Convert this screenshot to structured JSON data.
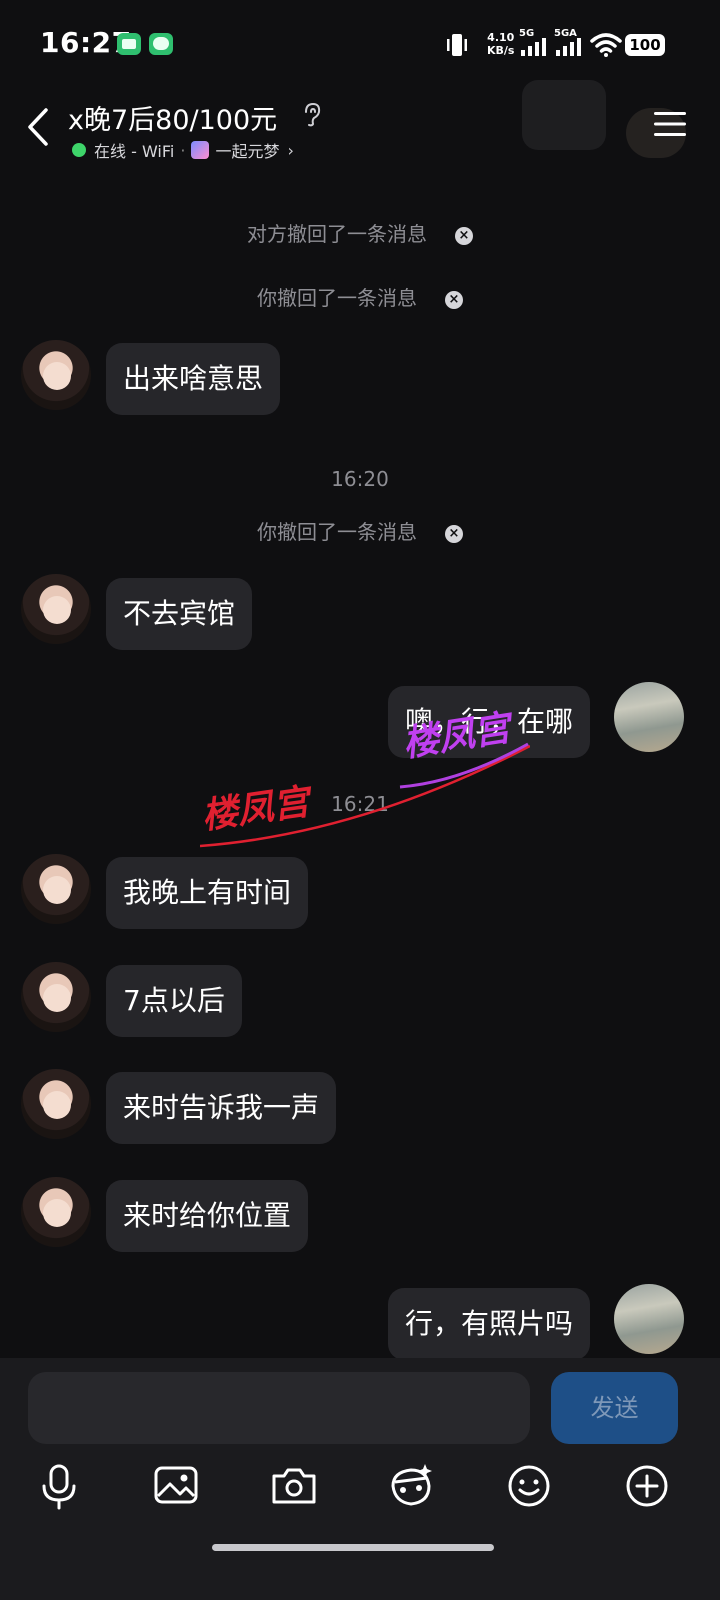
{
  "status_bar": {
    "time": "16:27",
    "net_speed_value": "4.10",
    "net_speed_unit": "KB/s",
    "sim1_label": "5G",
    "sim2_label": "5GA",
    "battery": "100"
  },
  "header": {
    "title": "x晚7后80/100元",
    "online_status": "在线 - WiFi",
    "activity": "一起元梦"
  },
  "messages": {
    "sys1": "对方撤回了一条消息",
    "sys2": "你撤回了一条消息",
    "m1": "出来啥意思",
    "time1": "16:20",
    "sys3": "你撤回了一条消息",
    "m2": "不去宾馆",
    "m3": "噢，行，在哪",
    "time2": "16:21",
    "m4": "我晚上有时间",
    "m5": "7点以后",
    "m6": "来时告诉我一声",
    "m7": "来时给你位置",
    "m8": "行，有照片吗"
  },
  "watermark": {
    "text1": "楼凤宫",
    "text2": "楼凤宫"
  },
  "composer": {
    "input_value": "",
    "send_label": "发送"
  }
}
